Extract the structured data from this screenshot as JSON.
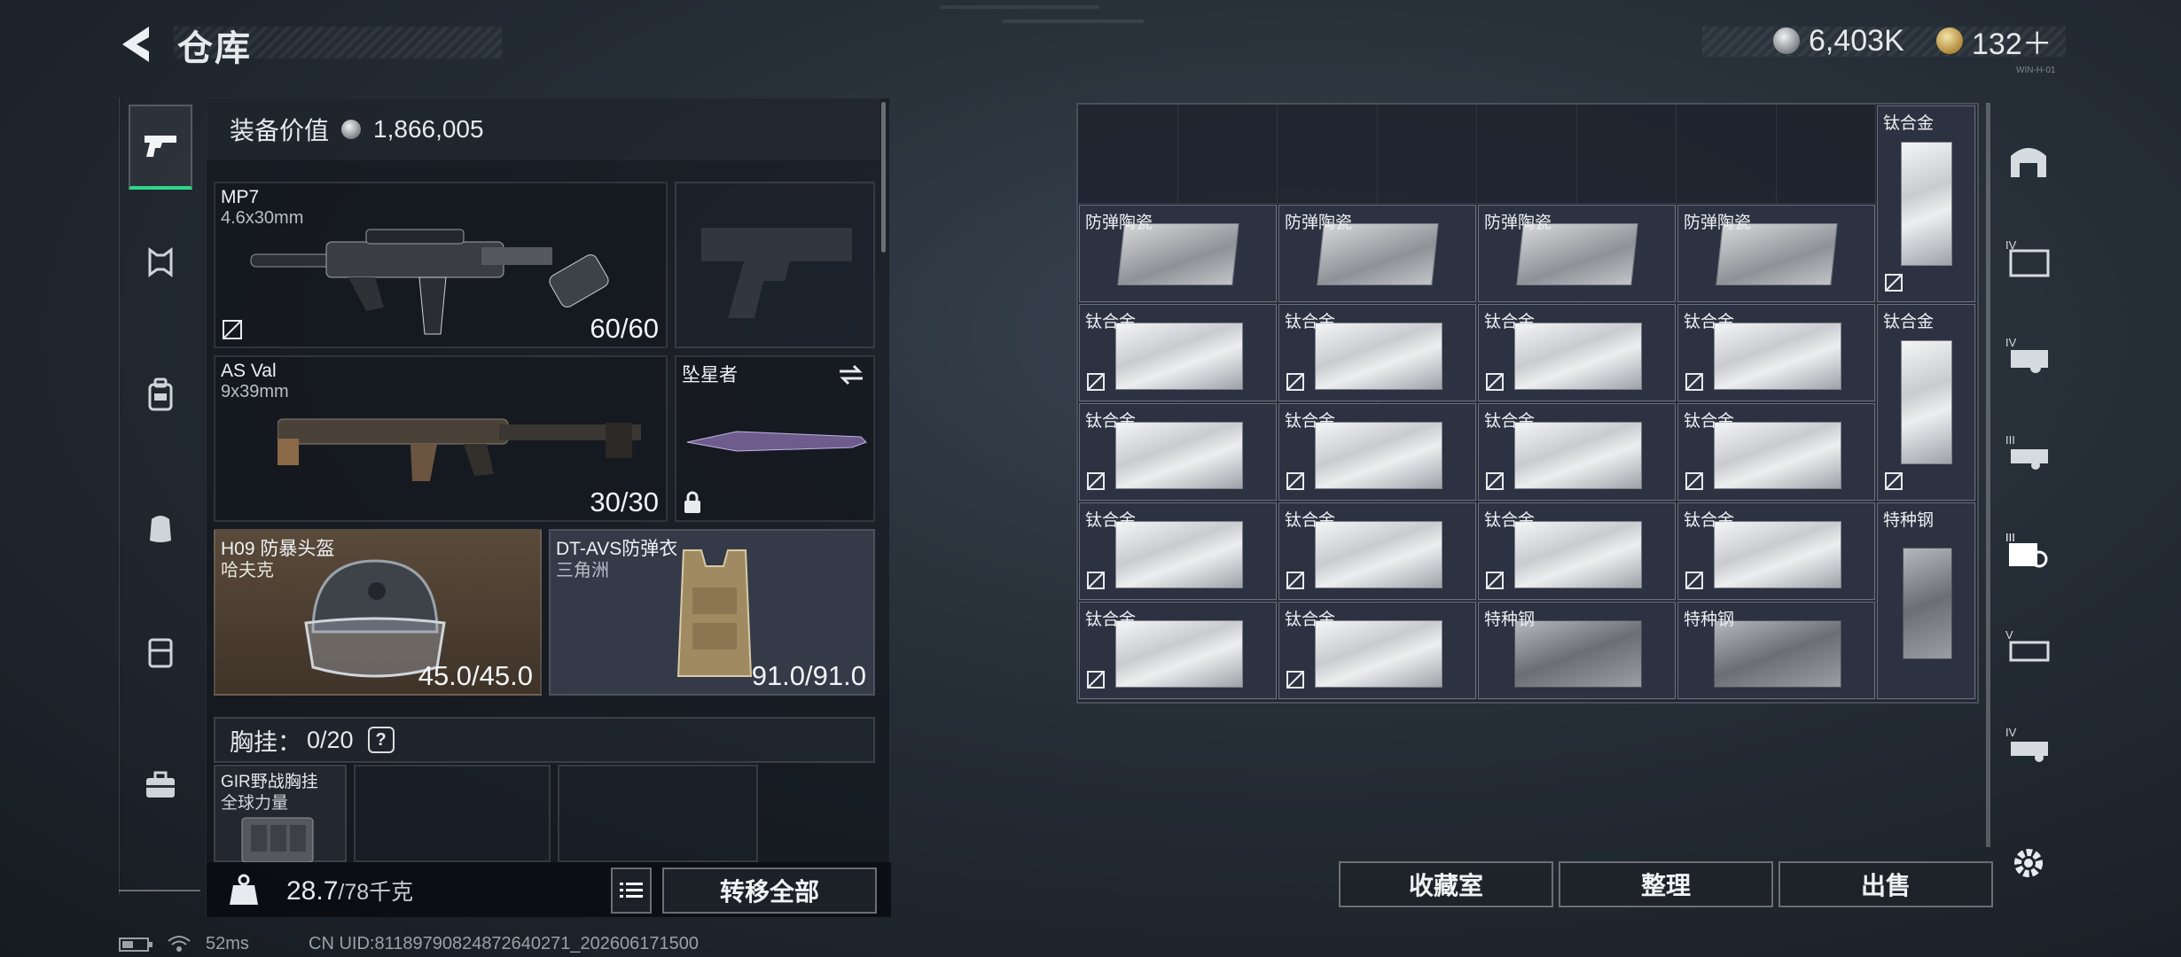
{
  "header": {
    "title": "仓库",
    "currency_silver": "6,403K",
    "currency_gold": "132＋",
    "small_tag": "WIN-H-01"
  },
  "left_panel": {
    "value_label": "装备价值",
    "value_amount": "1,866,005",
    "weapons": [
      {
        "name": "MP7",
        "caliber": "4.6x30mm",
        "ammo": "60/60"
      },
      {
        "name": "AS Val",
        "caliber": "9x39mm",
        "ammo": "30/30"
      }
    ],
    "melee": {
      "name": "坠星者"
    },
    "helmet": {
      "name": "H09 防暴头盔",
      "maker": "哈夫克",
      "durability": "45.0/45.0"
    },
    "armor": {
      "name": "DT-AVS防弹衣",
      "maker": "三角洲",
      "durability": "91.0/91.0"
    },
    "chest": {
      "label": "胸挂：",
      "capacity": "0/20",
      "help": "?"
    },
    "chest_item": {
      "name": "GIR野战胸挂",
      "maker": "全球力量"
    },
    "weight_value": "28.7",
    "weight_max": "/78千克",
    "transfer_all": "转移全部"
  },
  "grid": {
    "items": [
      {
        "name": "钛合金",
        "col": 8,
        "row": 0,
        "w": 1,
        "h": 2,
        "kind": "tall-metal"
      },
      {
        "name": "防弹陶瓷",
        "col": 0,
        "row": 1,
        "w": 1,
        "h": 1,
        "kind": "ceramic"
      },
      {
        "name": "防弹陶瓷",
        "col": 2,
        "row": 1,
        "w": 1,
        "h": 1,
        "kind": "ceramic"
      },
      {
        "name": "防弹陶瓷",
        "col": 4,
        "row": 1,
        "w": 1,
        "h": 1,
        "kind": "ceramic"
      },
      {
        "name": "防弹陶瓷",
        "col": 6,
        "row": 1,
        "w": 1,
        "h": 1,
        "kind": "ceramic"
      },
      {
        "name": "钛合金",
        "col": 0,
        "row": 2,
        "w": 1,
        "h": 1,
        "kind": "metal"
      },
      {
        "name": "钛合金",
        "col": 2,
        "row": 2,
        "w": 1,
        "h": 1,
        "kind": "metal"
      },
      {
        "name": "钛合金",
        "col": 4,
        "row": 2,
        "w": 1,
        "h": 1,
        "kind": "metal"
      },
      {
        "name": "钛合金",
        "col": 6,
        "row": 2,
        "w": 1,
        "h": 1,
        "kind": "metal"
      },
      {
        "name": "钛合金",
        "col": 8,
        "row": 2,
        "w": 1,
        "h": 2,
        "kind": "tall-metal"
      },
      {
        "name": "钛合金",
        "col": 0,
        "row": 3,
        "w": 1,
        "h": 1,
        "kind": "metal"
      },
      {
        "name": "钛合金",
        "col": 2,
        "row": 3,
        "w": 1,
        "h": 1,
        "kind": "metal"
      },
      {
        "name": "钛合金",
        "col": 4,
        "row": 3,
        "w": 1,
        "h": 1,
        "kind": "metal"
      },
      {
        "name": "钛合金",
        "col": 6,
        "row": 3,
        "w": 1,
        "h": 1,
        "kind": "metal"
      },
      {
        "name": "钛合金",
        "col": 0,
        "row": 4,
        "w": 1,
        "h": 1,
        "kind": "metal"
      },
      {
        "name": "钛合金",
        "col": 2,
        "row": 4,
        "w": 1,
        "h": 1,
        "kind": "metal"
      },
      {
        "name": "钛合金",
        "col": 4,
        "row": 4,
        "w": 1,
        "h": 1,
        "kind": "metal"
      },
      {
        "name": "钛合金",
        "col": 6,
        "row": 4,
        "w": 1,
        "h": 1,
        "kind": "metal"
      },
      {
        "name": "特种钢",
        "col": 8,
        "row": 4,
        "w": 1,
        "h": 2,
        "kind": "tall-steel"
      },
      {
        "name": "钛合金",
        "col": 0,
        "row": 5,
        "w": 1,
        "h": 1,
        "kind": "metal"
      },
      {
        "name": "钛合金",
        "col": 2,
        "row": 5,
        "w": 1,
        "h": 1,
        "kind": "metal"
      },
      {
        "name": "特种钢",
        "col": 4,
        "row": 5,
        "w": 1,
        "h": 1,
        "kind": "steel"
      },
      {
        "name": "特种钢",
        "col": 6,
        "row": 5,
        "w": 1,
        "h": 1,
        "kind": "steel"
      }
    ],
    "buttons": {
      "collection": "收藏室",
      "sort": "整理",
      "sell": "出售"
    }
  },
  "right_rail": {
    "items": [
      "safe-house-icon",
      "tier-iv-weapon-case-icon",
      "tier-iv-gun-case-icon",
      "tier-iii-gun-case-icon",
      "tier-iii-ammo-case-icon",
      "tier-v-gun-case-icon",
      "tier-iv-ammo-case-icon",
      "settings-icon"
    ]
  },
  "status": {
    "ping": "52ms",
    "uid": "CN UID:81189790824872640271_202606171500"
  },
  "colors": {
    "accent_green": "#2fd88a",
    "helmet_slot": "#5a4a3a",
    "grid_bg": "#1e222e"
  }
}
